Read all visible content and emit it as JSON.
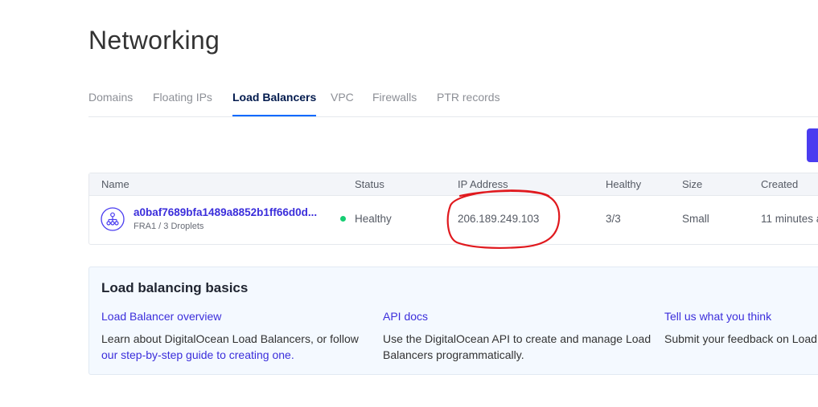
{
  "page": {
    "title": "Networking"
  },
  "tabs": [
    {
      "label": "Domains",
      "active": false
    },
    {
      "label": "Floating IPs",
      "active": false
    },
    {
      "label": "Load Balancers",
      "active": true
    },
    {
      "label": "VPC",
      "active": false
    },
    {
      "label": "Firewalls",
      "active": false
    },
    {
      "label": "PTR records",
      "active": false
    }
  ],
  "table": {
    "columns": [
      "Name",
      "Status",
      "IP Address",
      "Healthy",
      "Size",
      "Created"
    ],
    "rows": [
      {
        "icon": "load-balancer-icon",
        "name": "a0baf7689bfa1489a8852b1ff66d0d...",
        "subtitle": "FRA1 / 3 Droplets",
        "status": "Healthy",
        "status_color": "#15cd72",
        "ip_address": "206.189.249.103",
        "healthy": "3/3",
        "size": "Small",
        "created": "11 minutes a"
      }
    ]
  },
  "basics": {
    "title": "Load balancing basics",
    "columns": [
      {
        "link": "Load Balancer overview",
        "text": "Learn about DigitalOcean Load Balancers, or follow ",
        "inline_link": "our step-by-step guide to creating one."
      },
      {
        "link": "API docs",
        "text": "Use the DigitalOcean API to create and manage Load Balancers programmatically.",
        "inline_link": ""
      },
      {
        "link": "Tell us what you think",
        "text": "Submit your feedback on Load",
        "inline_link": ""
      }
    ]
  },
  "colors": {
    "brand": "#4a3cf0",
    "link": "#3b2edb",
    "annotation": "#e0191e"
  }
}
